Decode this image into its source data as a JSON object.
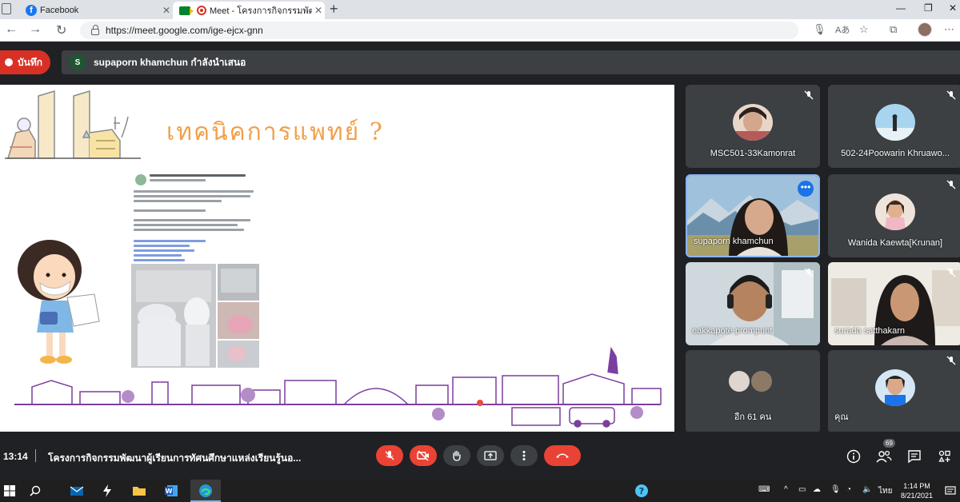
{
  "browser": {
    "tabs": [
      {
        "label": "Facebook",
        "icon": "facebook-icon"
      },
      {
        "label": "Meet - โครงการกิจกรรมพัฒนา",
        "icon": "meet-icon",
        "recording_icon": "record-icon"
      }
    ],
    "url": "https://meet.google.com/ige-ejcx-gnn",
    "colors": {
      "tab_strip": "#dee1e6",
      "omnibox": "#f1f3f4"
    }
  },
  "meet": {
    "record_label": "บันทึก",
    "presenter_initial": "S",
    "presenter_text": "supaporn khamchun กำลังนำเสนอ",
    "slide_title": "เทคนิคการแพทย์ ?",
    "participants": [
      {
        "name": "MSC501-33Kamonrat",
        "muted": true
      },
      {
        "name": "502-24Poowarin Khruawo...",
        "muted": true
      },
      {
        "name": "supaporn khamchun",
        "muted": false,
        "speaking": true
      },
      {
        "name": "Wanida Kaewta[Krunan]",
        "muted": true
      },
      {
        "name": "eakkapote prompunt",
        "muted": true
      },
      {
        "name": "surada satthakarn",
        "muted": true
      },
      {
        "name": "อีก 61 คน",
        "muted": false
      },
      {
        "name": "คุณ",
        "muted": true
      }
    ],
    "clock": "13:14",
    "meeting_name": "โครงการกิจกรรมพัฒนาผู้เรียนการทัศนศึกษาแหล่งเรียนรู้นอ...",
    "participant_count": "69",
    "colors": {
      "red": "#ea4335",
      "dark": "#202124",
      "tile": "#3c4043",
      "highlight": "#8ab4f8",
      "title_orange": "#f0a04b",
      "purple": "#7b3f9e"
    }
  },
  "taskbar": {
    "time": "1:14 PM",
    "date": "8/21/2021",
    "language": "ไทย"
  }
}
